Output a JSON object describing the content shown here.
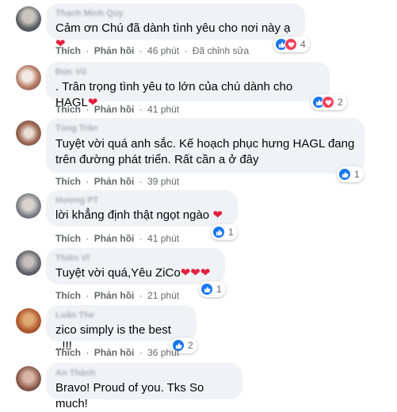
{
  "actions": {
    "like": "Thích",
    "reply": "Phản hồi",
    "sep": "·"
  },
  "comments": [
    {
      "author": "Thạch Minh Quy",
      "text": "Cảm ơn Chú đã dành tình yêu cho nơi này ạ",
      "time": "46 phút",
      "edited": "Đã chỉnh sửa",
      "reaction_count": "4"
    },
    {
      "author": "Đức Vũ",
      "text": ". Trân trọng tình yêu to lớn của chú dành cho HAGL",
      "time": "41 phút",
      "reaction_count": "2"
    },
    {
      "author": "Tùng Trần",
      "text_line1": "Tuyệt vời quá anh sắc. Kế hoạch phục hưng HAGL đang",
      "text_line2": "trên đường phát triển. Rất cần a ở đây",
      "time": "39 phút",
      "reaction_count": "1"
    },
    {
      "author": "Hương PT",
      "text": "lời khẳng định thật ngọt ngào",
      "time": "41 phút",
      "reaction_count": "1"
    },
    {
      "author": "Thiên Vĩ",
      "text": "Tuyệt vời quá,Yêu ZiCo",
      "time": "21 phút",
      "reaction_count": "1"
    },
    {
      "author": "Luân The",
      "text": "zico simply is the best ..!!!",
      "time": "36 phút",
      "reaction_count": "2"
    },
    {
      "author": "An Thành",
      "text": "Bravo! Proud of you. Tks So much!"
    }
  ],
  "colors": {
    "like": "#1877f2",
    "love": "#f33e58",
    "heart": "#e41e3f",
    "bubble": "#f0f2f5",
    "meta": "#65676b"
  }
}
